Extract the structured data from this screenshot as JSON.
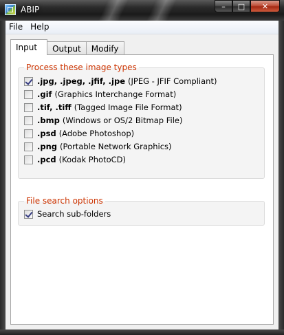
{
  "window": {
    "title": "ABIP",
    "minimize": "–",
    "maximize": "□",
    "close": "✕"
  },
  "menu": [
    "File",
    "Help"
  ],
  "tabs": [
    "Input",
    "Output",
    "Modify"
  ],
  "image_types": {
    "title": "Process these image types",
    "items": [
      {
        "ext": ".jpg, .jpeg, .jfif, .jpe",
        "desc": "(JPEG - JFIF Compliant)",
        "checked": true
      },
      {
        "ext": ".gif",
        "desc": "(Graphics Interchange Format)",
        "checked": false
      },
      {
        "ext": ".tif, .tiff",
        "desc": "(Tagged Image File Format)",
        "checked": false
      },
      {
        "ext": ".bmp",
        "desc": "(Windows or OS/2 Bitmap File)",
        "checked": false
      },
      {
        "ext": ".psd",
        "desc": "(Adobe Photoshop)",
        "checked": false
      },
      {
        "ext": ".png",
        "desc": "(Portable Network Graphics)",
        "checked": false
      },
      {
        "ext": ".pcd",
        "desc": "(Kodak PhotoCD)",
        "checked": false
      }
    ]
  },
  "search_options": {
    "title": "File search options",
    "subfolders_label": "Search sub-folders",
    "subfolders_checked": true
  }
}
